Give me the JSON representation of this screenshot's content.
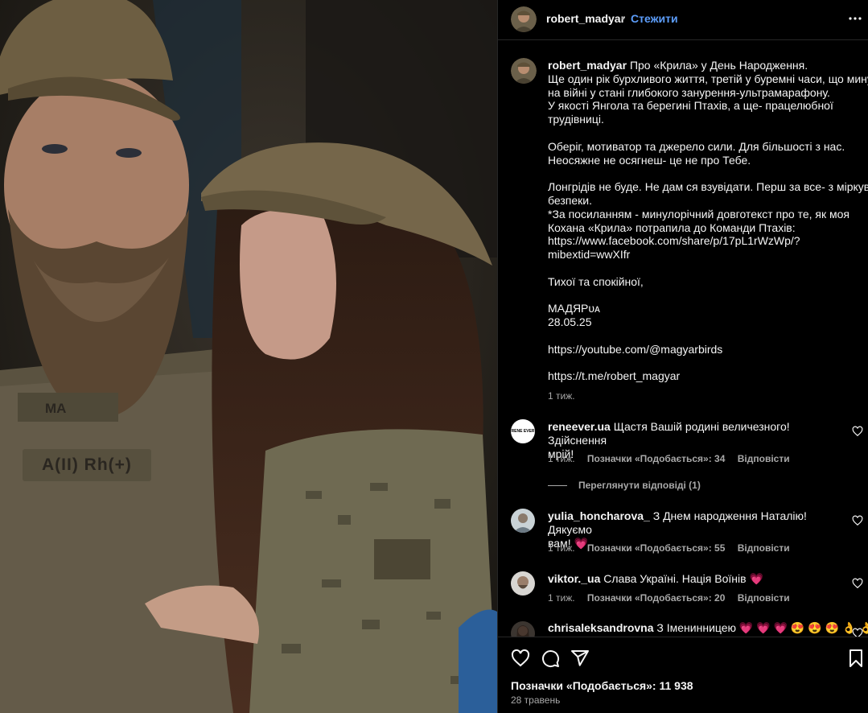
{
  "post": {
    "author": "robert_madyar",
    "follow_label": "Стежити",
    "separator": "•",
    "photo_patches": [
      "MA",
      "A(II) Rh(+)"
    ]
  },
  "caption": {
    "author": "robert_madyar",
    "lines": [
      "Про «Крила» у День Народження.",
      "Ще один рік бурхливого життя, третій у буремні часи, що минув",
      "на війні у стані глибокого занурення-ультрамарафону.",
      "У якості Янгола та берегині Птахів, а ще- працелюбної",
      "трудівниці.",
      "",
      "Оберіг, мотиватор та джерело сили. Для більшості з нас.",
      "Неосяжне не осягнеш- це не про Тебе.",
      "",
      "Лонгрідів не буде. Не дам ся взувідати. Перш за все- з міркувань",
      "безпеки.",
      "*За посиланням - минулорічний довготекст про те, як моя",
      "Кохана «Крила» потрапила до Команди Птахів:",
      "https://www.facebook.com/share/p/17pL1rWzWp/?",
      "mibextid=wwXIfr",
      "",
      "Тихої та спокійної,",
      "",
      "МАДЯРᴜᴀ",
      "28.05.25",
      "",
      "https://youtube.com/@magyarbirds",
      "",
      "https://t.me/robert_magyar"
    ],
    "time": "1 тиж."
  },
  "comments": [
    {
      "user": "reneever.ua",
      "text1": "Щастя Вашій родині величезного! Здійснення",
      "text2": "мрій!",
      "time": "1 тиж.",
      "likes": "Позначки «Подобається»: 34",
      "reply": "Відповісти",
      "view_replies": "Переглянути відповіді (1)",
      "avatar_text": "RENE EVER"
    },
    {
      "user": "yulia_honcharova_",
      "text1": "З Днем народження Наталію! Дякуємо",
      "text2": "вам! 💗",
      "time": "1 тиж.",
      "likes": "Позначки «Подобається»: 55",
      "reply": "Відповісти"
    },
    {
      "user": "viktor._ua",
      "text1": "Слава Україні. Нація Воїнів 💗",
      "time": "1 тиж.",
      "likes": "Позначки «Подобається»: 20",
      "reply": "Відповісти"
    },
    {
      "user": "chrisaleksandrovna",
      "text1": "З Іменинницею 💗 💗 💗 😍 😍 😍 👌 👌"
    }
  ],
  "footer": {
    "likes": "Позначки «Подобається»: 11 938",
    "date": "28 травень"
  },
  "colors": {
    "link": "#5c9dfa",
    "muted": "#a8a8a8",
    "border": "#262626"
  }
}
